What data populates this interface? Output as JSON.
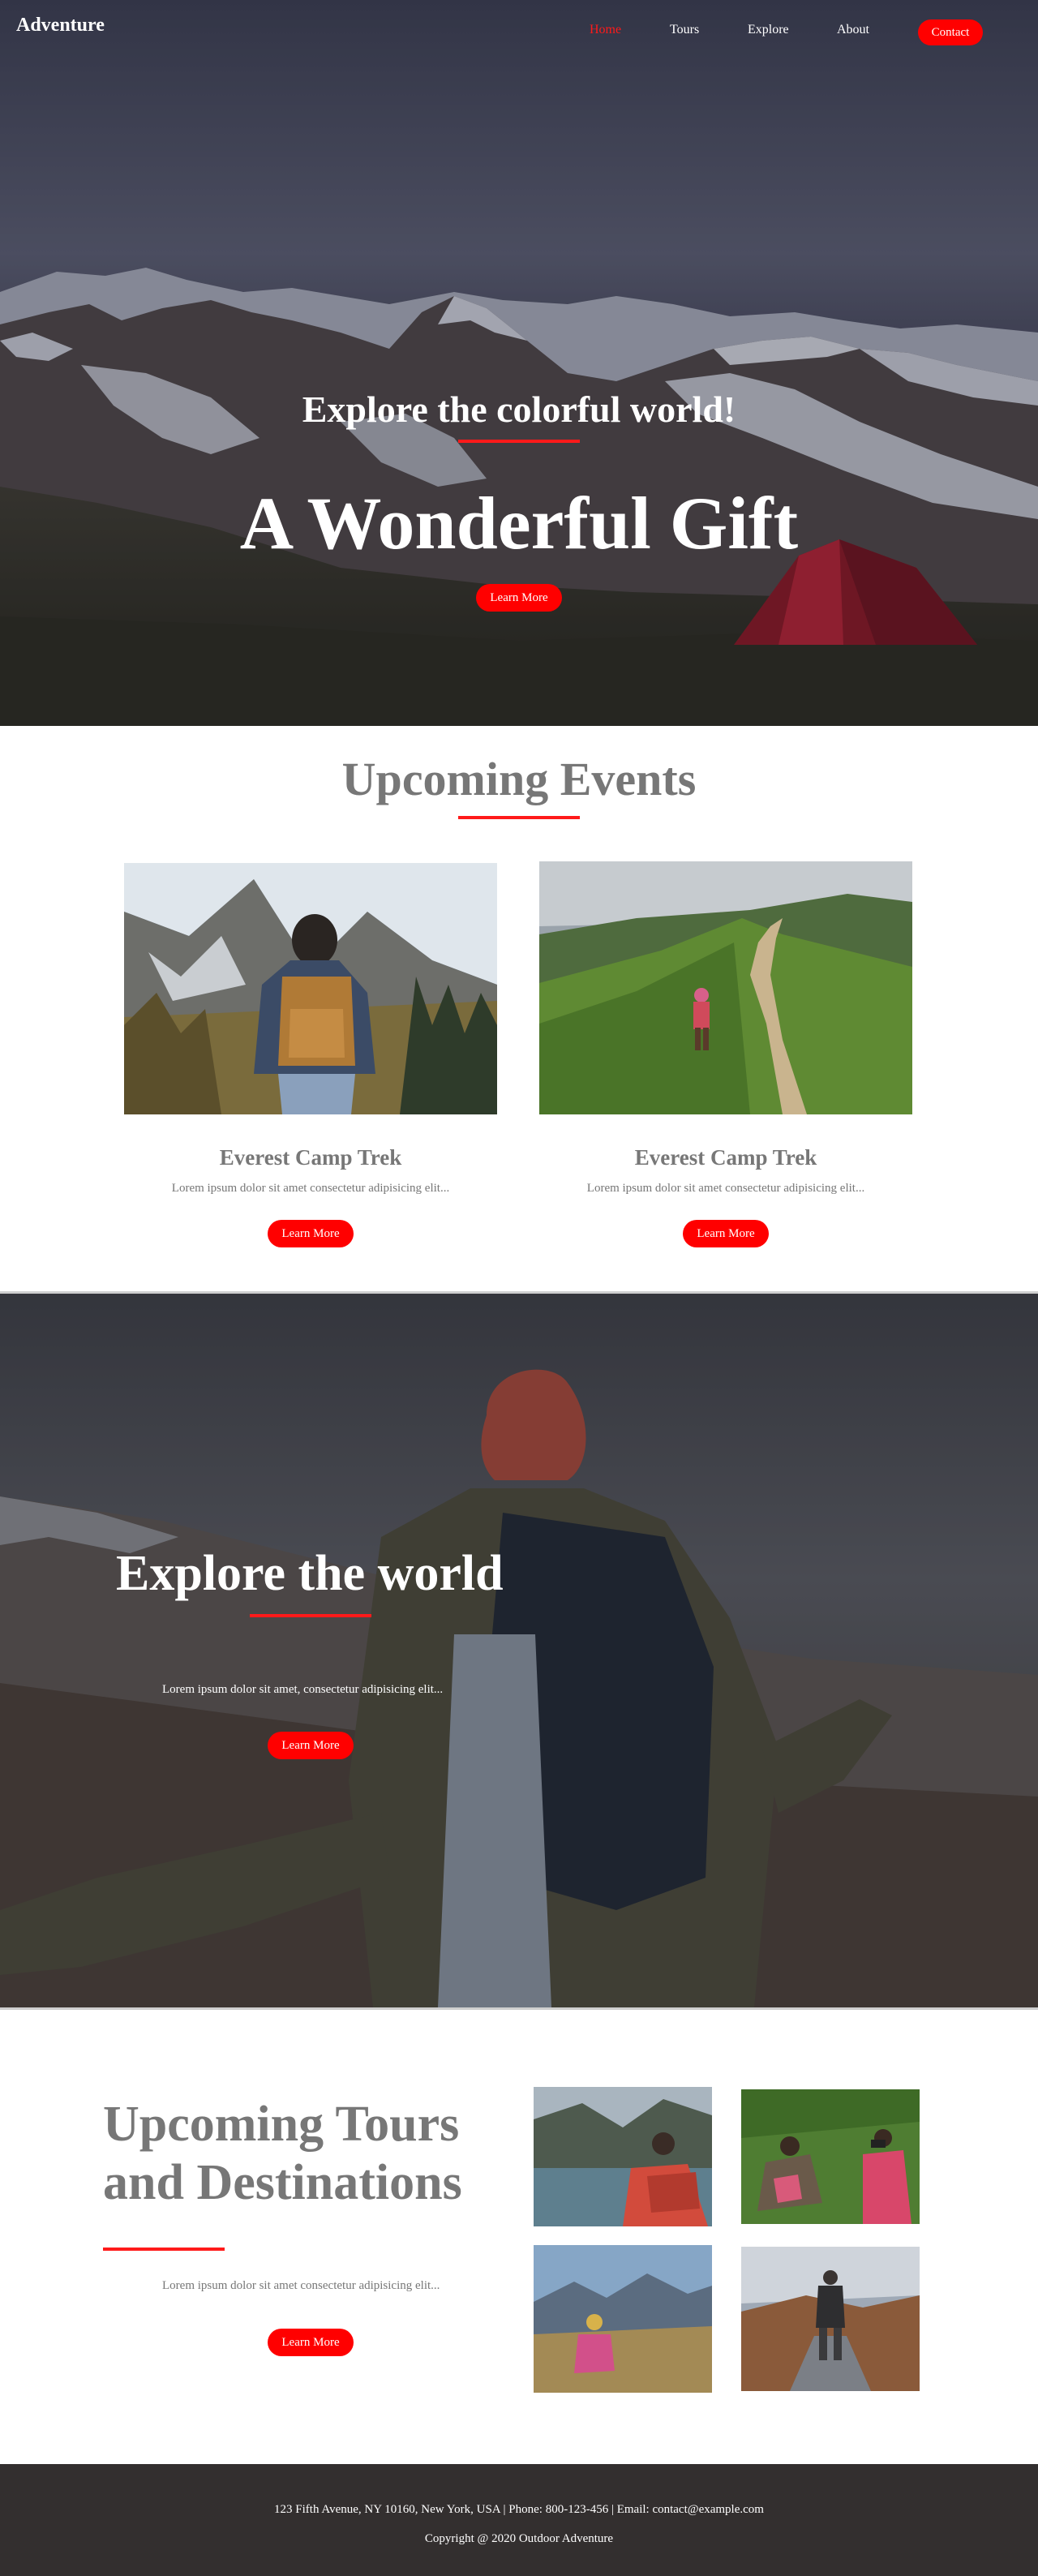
{
  "brand": "Adventure",
  "nav": {
    "items": [
      "Home",
      "Tours",
      "Explore",
      "About"
    ],
    "contact": "Contact",
    "active_color": "#ff1a1a"
  },
  "hero": {
    "subtitle": "Explore the colorful world!",
    "title": "A Wonderful Gift",
    "button": "Learn More"
  },
  "events": {
    "title": "Upcoming Events",
    "cards": [
      {
        "name": "Everest Camp Trek",
        "text": "Lorem ipsum dolor sit amet consectetur adipisicing elit...",
        "button": "Learn More"
      },
      {
        "name": "Everest Camp Trek",
        "text": "Lorem ipsum dolor sit amet consectetur adipisicing elit...",
        "button": "Learn More"
      }
    ]
  },
  "explore": {
    "title": "Explore the world",
    "text": "Lorem ipsum dolor sit amet, consectetur adipisicing elit...",
    "button": "Learn More"
  },
  "tours": {
    "title_line1": "Upcoming Tours",
    "title_line2": "and Destinations",
    "text": "Lorem ipsum dolor sit amet consectetur adipisicing elit...",
    "button": "Learn More"
  },
  "footer": {
    "info": "123 Fifth Avenue, NY 10160, New York, USA | Phone: 800-123-456 | Email: contact@example.com",
    "copyright": "Copyright @ 2020 Outdoor Adventure"
  },
  "colors": {
    "accent": "#ff0000",
    "heading_gray": "#777777",
    "footer_bg": "#332f2f"
  }
}
